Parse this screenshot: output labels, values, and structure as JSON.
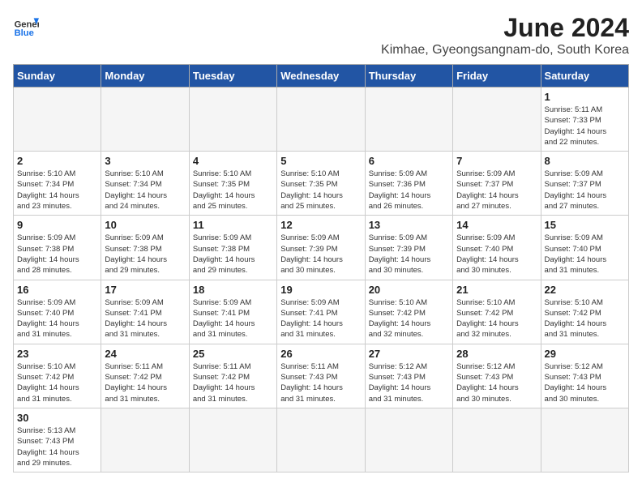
{
  "header": {
    "logo_general": "General",
    "logo_blue": "Blue",
    "title": "June 2024",
    "subtitle": "Kimhae, Gyeongsangnam-do, South Korea"
  },
  "days_of_week": [
    "Sunday",
    "Monday",
    "Tuesday",
    "Wednesday",
    "Thursday",
    "Friday",
    "Saturday"
  ],
  "weeks": [
    [
      {
        "day": "",
        "info": "",
        "empty": true
      },
      {
        "day": "",
        "info": "",
        "empty": true
      },
      {
        "day": "",
        "info": "",
        "empty": true
      },
      {
        "day": "",
        "info": "",
        "empty": true
      },
      {
        "day": "",
        "info": "",
        "empty": true
      },
      {
        "day": "",
        "info": "",
        "empty": true
      },
      {
        "day": "1",
        "info": "Sunrise: 5:11 AM\nSunset: 7:33 PM\nDaylight: 14 hours\nand 22 minutes."
      }
    ],
    [
      {
        "day": "2",
        "info": "Sunrise: 5:10 AM\nSunset: 7:34 PM\nDaylight: 14 hours\nand 23 minutes."
      },
      {
        "day": "3",
        "info": "Sunrise: 5:10 AM\nSunset: 7:34 PM\nDaylight: 14 hours\nand 24 minutes."
      },
      {
        "day": "4",
        "info": "Sunrise: 5:10 AM\nSunset: 7:35 PM\nDaylight: 14 hours\nand 25 minutes."
      },
      {
        "day": "5",
        "info": "Sunrise: 5:10 AM\nSunset: 7:35 PM\nDaylight: 14 hours\nand 25 minutes."
      },
      {
        "day": "6",
        "info": "Sunrise: 5:09 AM\nSunset: 7:36 PM\nDaylight: 14 hours\nand 26 minutes."
      },
      {
        "day": "7",
        "info": "Sunrise: 5:09 AM\nSunset: 7:37 PM\nDaylight: 14 hours\nand 27 minutes."
      },
      {
        "day": "8",
        "info": "Sunrise: 5:09 AM\nSunset: 7:37 PM\nDaylight: 14 hours\nand 27 minutes."
      }
    ],
    [
      {
        "day": "9",
        "info": "Sunrise: 5:09 AM\nSunset: 7:38 PM\nDaylight: 14 hours\nand 28 minutes."
      },
      {
        "day": "10",
        "info": "Sunrise: 5:09 AM\nSunset: 7:38 PM\nDaylight: 14 hours\nand 29 minutes."
      },
      {
        "day": "11",
        "info": "Sunrise: 5:09 AM\nSunset: 7:38 PM\nDaylight: 14 hours\nand 29 minutes."
      },
      {
        "day": "12",
        "info": "Sunrise: 5:09 AM\nSunset: 7:39 PM\nDaylight: 14 hours\nand 30 minutes."
      },
      {
        "day": "13",
        "info": "Sunrise: 5:09 AM\nSunset: 7:39 PM\nDaylight: 14 hours\nand 30 minutes."
      },
      {
        "day": "14",
        "info": "Sunrise: 5:09 AM\nSunset: 7:40 PM\nDaylight: 14 hours\nand 30 minutes."
      },
      {
        "day": "15",
        "info": "Sunrise: 5:09 AM\nSunset: 7:40 PM\nDaylight: 14 hours\nand 31 minutes."
      }
    ],
    [
      {
        "day": "16",
        "info": "Sunrise: 5:09 AM\nSunset: 7:40 PM\nDaylight: 14 hours\nand 31 minutes."
      },
      {
        "day": "17",
        "info": "Sunrise: 5:09 AM\nSunset: 7:41 PM\nDaylight: 14 hours\nand 31 minutes."
      },
      {
        "day": "18",
        "info": "Sunrise: 5:09 AM\nSunset: 7:41 PM\nDaylight: 14 hours\nand 31 minutes."
      },
      {
        "day": "19",
        "info": "Sunrise: 5:09 AM\nSunset: 7:41 PM\nDaylight: 14 hours\nand 31 minutes."
      },
      {
        "day": "20",
        "info": "Sunrise: 5:10 AM\nSunset: 7:42 PM\nDaylight: 14 hours\nand 32 minutes."
      },
      {
        "day": "21",
        "info": "Sunrise: 5:10 AM\nSunset: 7:42 PM\nDaylight: 14 hours\nand 32 minutes."
      },
      {
        "day": "22",
        "info": "Sunrise: 5:10 AM\nSunset: 7:42 PM\nDaylight: 14 hours\nand 31 minutes."
      }
    ],
    [
      {
        "day": "23",
        "info": "Sunrise: 5:10 AM\nSunset: 7:42 PM\nDaylight: 14 hours\nand 31 minutes."
      },
      {
        "day": "24",
        "info": "Sunrise: 5:11 AM\nSunset: 7:42 PM\nDaylight: 14 hours\nand 31 minutes."
      },
      {
        "day": "25",
        "info": "Sunrise: 5:11 AM\nSunset: 7:42 PM\nDaylight: 14 hours\nand 31 minutes."
      },
      {
        "day": "26",
        "info": "Sunrise: 5:11 AM\nSunset: 7:43 PM\nDaylight: 14 hours\nand 31 minutes."
      },
      {
        "day": "27",
        "info": "Sunrise: 5:12 AM\nSunset: 7:43 PM\nDaylight: 14 hours\nand 31 minutes."
      },
      {
        "day": "28",
        "info": "Sunrise: 5:12 AM\nSunset: 7:43 PM\nDaylight: 14 hours\nand 30 minutes."
      },
      {
        "day": "29",
        "info": "Sunrise: 5:12 AM\nSunset: 7:43 PM\nDaylight: 14 hours\nand 30 minutes."
      }
    ],
    [
      {
        "day": "30",
        "info": "Sunrise: 5:13 AM\nSunset: 7:43 PM\nDaylight: 14 hours\nand 29 minutes."
      },
      {
        "day": "",
        "info": "",
        "empty": true
      },
      {
        "day": "",
        "info": "",
        "empty": true
      },
      {
        "day": "",
        "info": "",
        "empty": true
      },
      {
        "day": "",
        "info": "",
        "empty": true
      },
      {
        "day": "",
        "info": "",
        "empty": true
      },
      {
        "day": "",
        "info": "",
        "empty": true
      }
    ]
  ]
}
